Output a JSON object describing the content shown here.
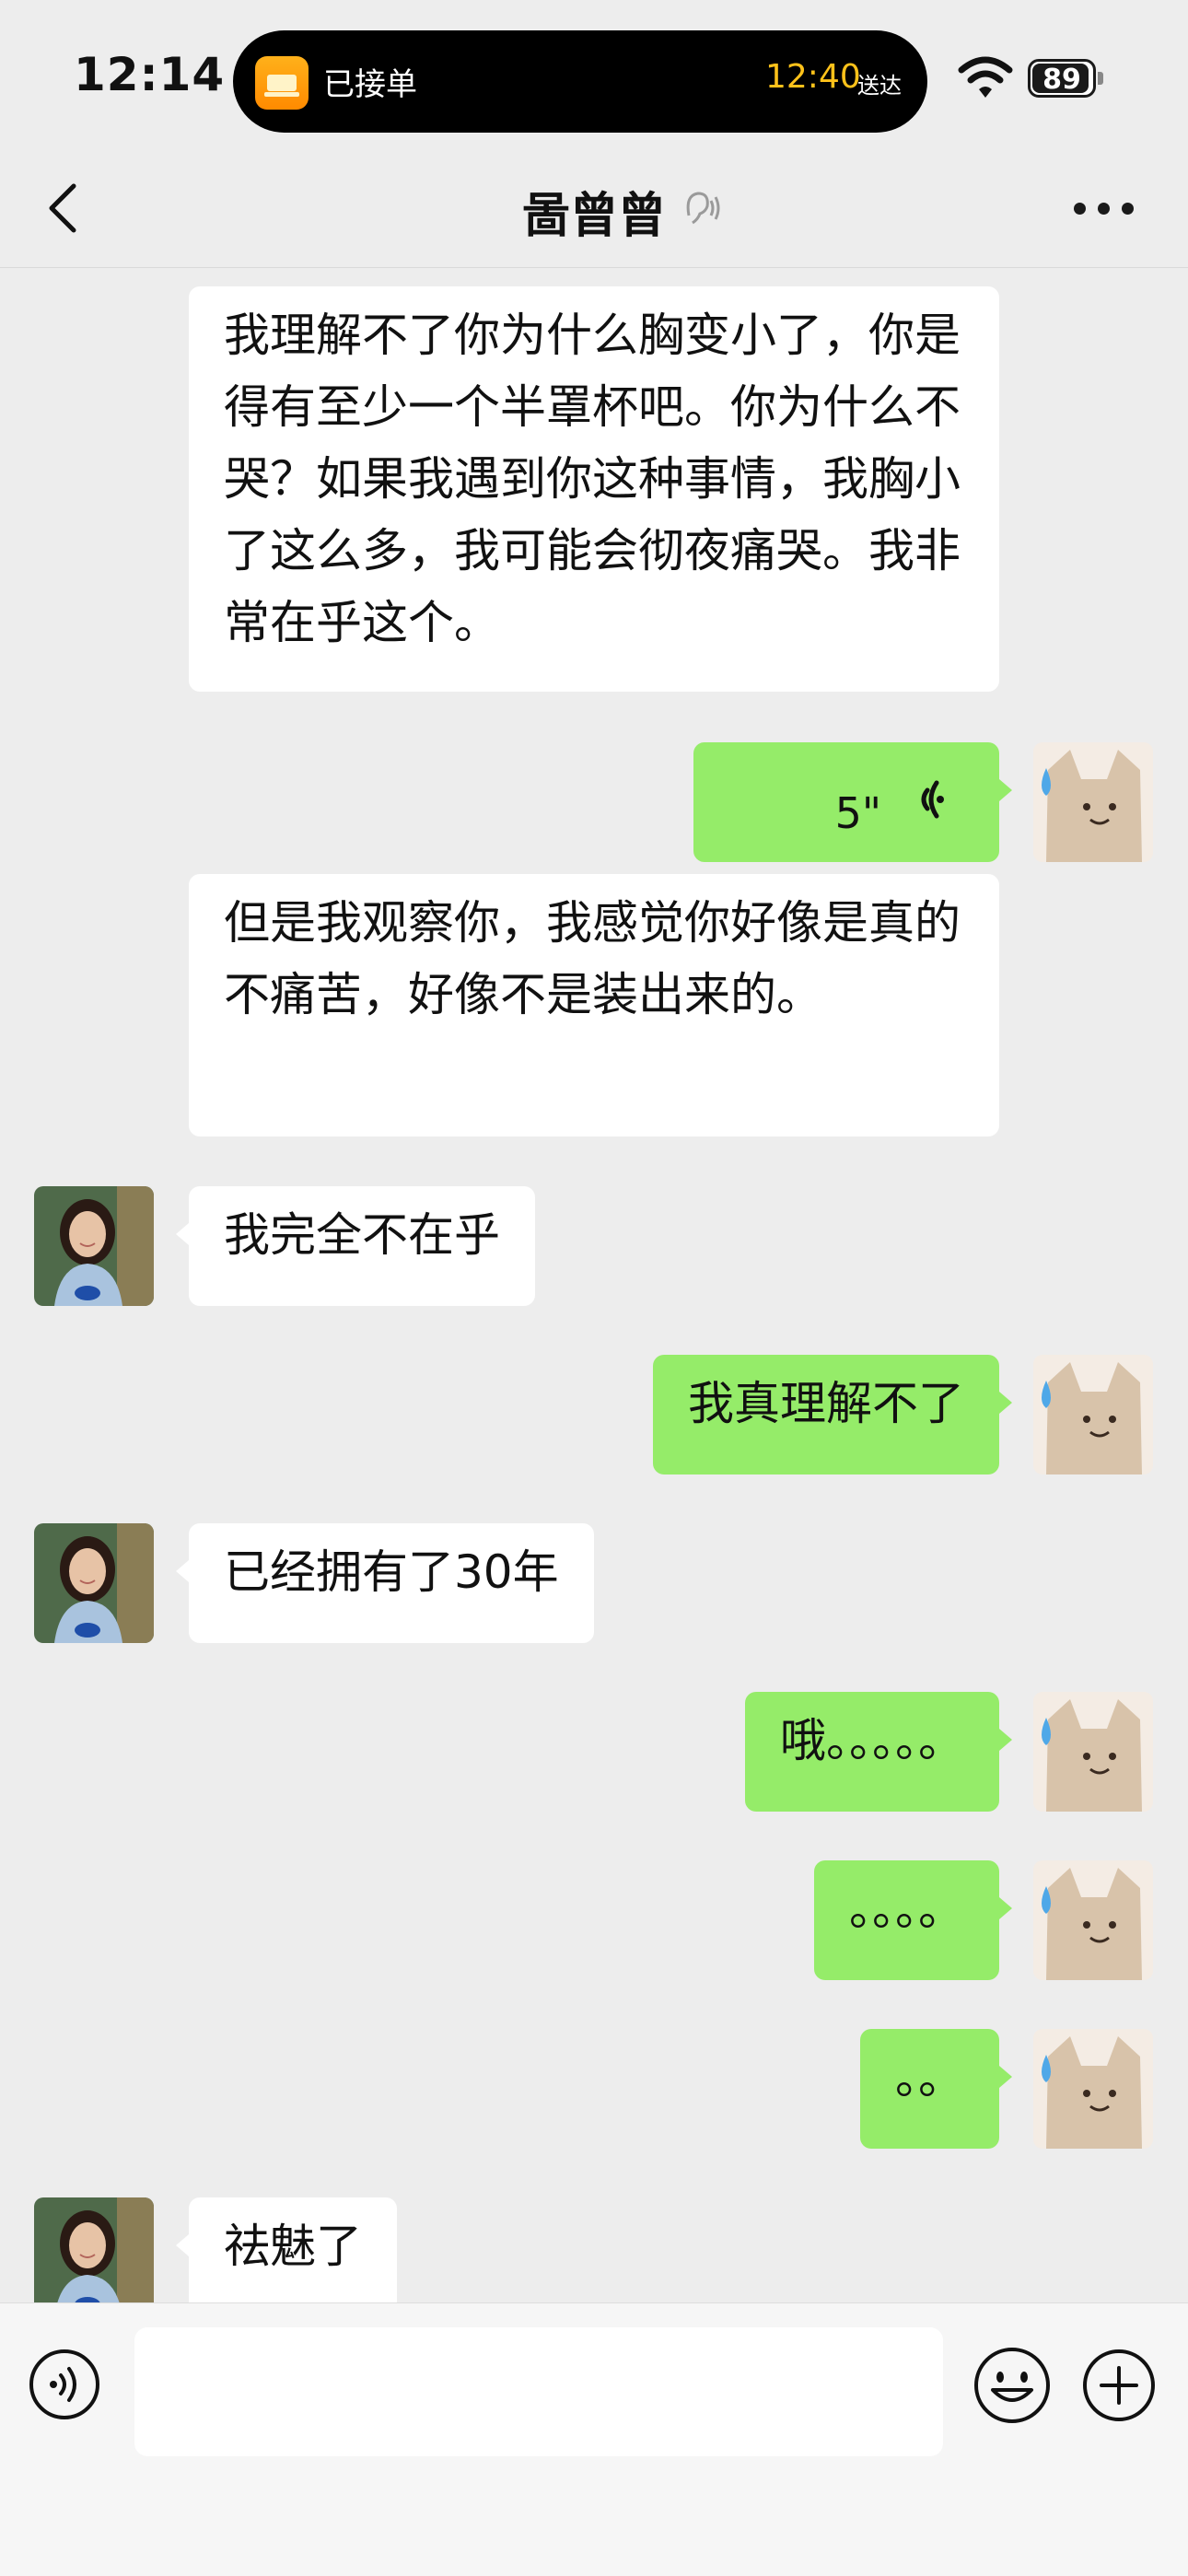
{
  "status": {
    "time": "12:14",
    "battery": "89"
  },
  "live_activity": {
    "label": "已接单",
    "time": "12:40",
    "sub": "送达"
  },
  "nav": {
    "title": "啚曾曾"
  },
  "messages": {
    "m1": "我理解不了你为什么胸变小了，你是得有至少一个半罩杯吧。你为什么不哭？如果我遇到你这种事情，我胸小了这么多，我可能会彻夜痛哭。我非常在乎这个。",
    "m2_voice_duration": "5\"",
    "m3": "但是我观察你，我感觉你好像是真的不痛苦，好像不是装出来的。",
    "m4": "我完全不在乎",
    "m5": "我真理解不了",
    "m6": "已经拥有了30年",
    "m7": "哦。。。。。",
    "m8": "。。。。",
    "m9": "。。",
    "m10": "祛魅了"
  },
  "colors": {
    "self_bubble": "#95ec69",
    "other_bubble": "#ffffff",
    "background": "#ededed"
  },
  "icons": [
    "back-arrow-icon",
    "ear-icon",
    "more-icon",
    "voice-wave-icon",
    "voice-input-icon",
    "emoji-icon",
    "plus-icon",
    "wifi-icon",
    "battery-icon"
  ]
}
